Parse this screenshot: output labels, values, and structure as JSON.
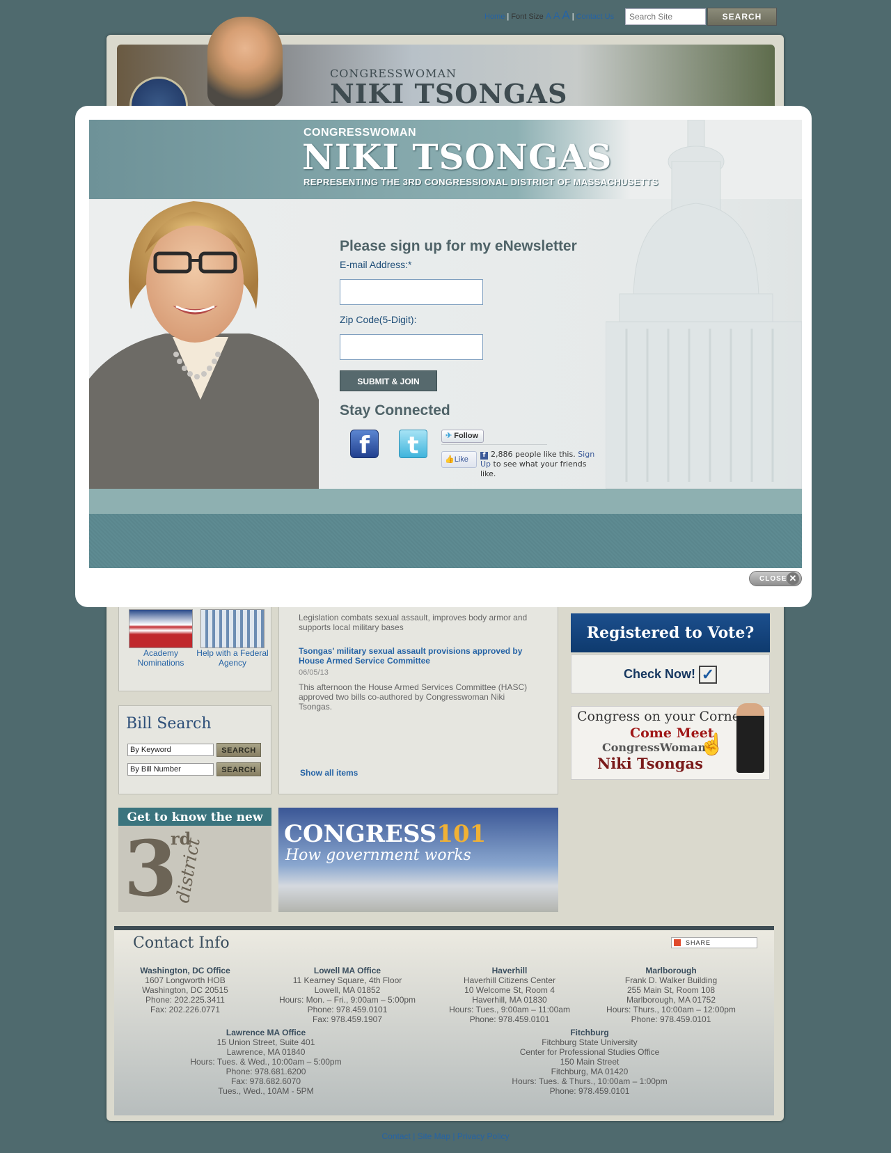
{
  "top_nav": {
    "home": "Home",
    "font_size_label": "Font Size",
    "font_a_small": "A",
    "font_a_medium": "A",
    "font_a_large": "A",
    "contact_us": "Contact Us",
    "search_placeholder": "Search Site",
    "search_button": "SEARCH",
    "separator": "|"
  },
  "header": {
    "small_title": "CONGRESSWOMAN",
    "big_title": "NIKI TSONGAS"
  },
  "left_column": {
    "academy_label": "Academy Nominations",
    "agency_label": "Help with a Federal Agency",
    "bill_search": {
      "title": "Bill Search",
      "keyword_value": "By Keyword",
      "bill_number_value": "By Bill Number",
      "search_button": "SEARCH"
    },
    "know_banner_text": "Get to know the new",
    "know_banner_number": "3",
    "know_banner_suffix": "rd",
    "know_banner_word": "district"
  },
  "news": {
    "items": [
      {
        "summary": "Legislation combats sexual assault, improves body armor and supports local military bases"
      },
      {
        "title": "Tsongas' military sexual assault provisions approved by House Armed Service Committee",
        "date": "06/05/13",
        "summary": "This afternoon the House Armed Services Committee (HASC) approved two bills co-authored by Congresswoman Niki Tsongas."
      }
    ],
    "show_all": "Show all items"
  },
  "congress_banner": {
    "title_a": "CONGRESS",
    "title_b": "101",
    "subtitle": "How government works"
  },
  "right_column": {
    "vote": "Registered to Vote?",
    "check": "Check Now!",
    "corner": {
      "line1": "Congress on your Corner",
      "line2": "Come Meet",
      "line3": "CongressWoman",
      "line4": "Niki Tsongas"
    }
  },
  "contact": {
    "title": "Contact Info",
    "share_label": "SHARE",
    "offices": [
      {
        "name": "Washington, DC Office",
        "lines": [
          "1607 Longworth HOB",
          "Washington, DC 20515",
          "Phone: 202.225.3411",
          "Fax: 202.226.0771"
        ]
      },
      {
        "name": "Lowell MA Office",
        "lines": [
          "11 Kearney Square, 4th Floor",
          "Lowell, MA 01852",
          "Hours: Mon. – Fri., 9:00am – 5:00pm",
          "Phone: 978.459.0101",
          "Fax: 978.459.1907"
        ]
      },
      {
        "name": "Haverhill",
        "lines": [
          "Haverhill Citizens Center",
          "10 Welcome St, Room 4",
          "Haverhill, MA 01830",
          "Hours: Tues., 9:00am – 11:00am",
          "Phone: 978.459.0101"
        ]
      },
      {
        "name": "Marlborough",
        "lines": [
          "Frank D. Walker Building",
          "255 Main St, Room 108",
          "Marlborough, MA 01752",
          "Hours: Thurs., 10:00am – 12:00pm",
          "Phone: 978.459.0101"
        ]
      },
      {
        "name": "Lawrence MA Office",
        "lines": [
          "15 Union Street, Suite 401",
          "Lawrence, MA 01840",
          "Hours: Tues. & Wed., 10:00am – 5:00pm",
          "Phone: 978.681.6200",
          "Fax: 978.682.6070",
          "Tues., Wed., 10AM - 5PM"
        ]
      },
      {
        "name": "Fitchburg",
        "lines": [
          "Fitchburg State University",
          "Center for Professional Studies Office",
          "150 Main Street",
          "Fitchburg, MA 01420",
          "Hours: Tues. & Thurs., 10:00am – 1:00pm",
          "Phone: 978.459.0101"
        ]
      }
    ]
  },
  "footer": {
    "contact": "Contact",
    "site_map": "Site Map",
    "privacy": "Privacy Policy",
    "separator": "|"
  },
  "modal": {
    "congresswoman": "CONGRESSWOMAN",
    "name": "NIKI TSONGAS",
    "representing": "REPRESENTING THE 3RD CONGRESSIONAL DISTRICT OF MASSACHUSETTS",
    "heading": "Please sign up for my eNewsletter",
    "email_label": "E-mail Address:*",
    "zip_label": "Zip Code(5-Digit):",
    "submit": "SUBMIT & JOIN",
    "stay_connected": "Stay Connected",
    "facebook_glyph": "f",
    "twitter_glyph": "t",
    "follow": "Follow",
    "like": "Like",
    "like_count_text": "2,886 people like this.",
    "sign_up": "Sign Up",
    "like_rest": "to see what your friends like.",
    "close": "CLOSE",
    "close_x": "✕"
  },
  "colors": {
    "background": "#4f6a6e",
    "link": "#2563a5",
    "modal_teal": "#8eb0b1",
    "vote_blue": "#1c4f8d"
  }
}
